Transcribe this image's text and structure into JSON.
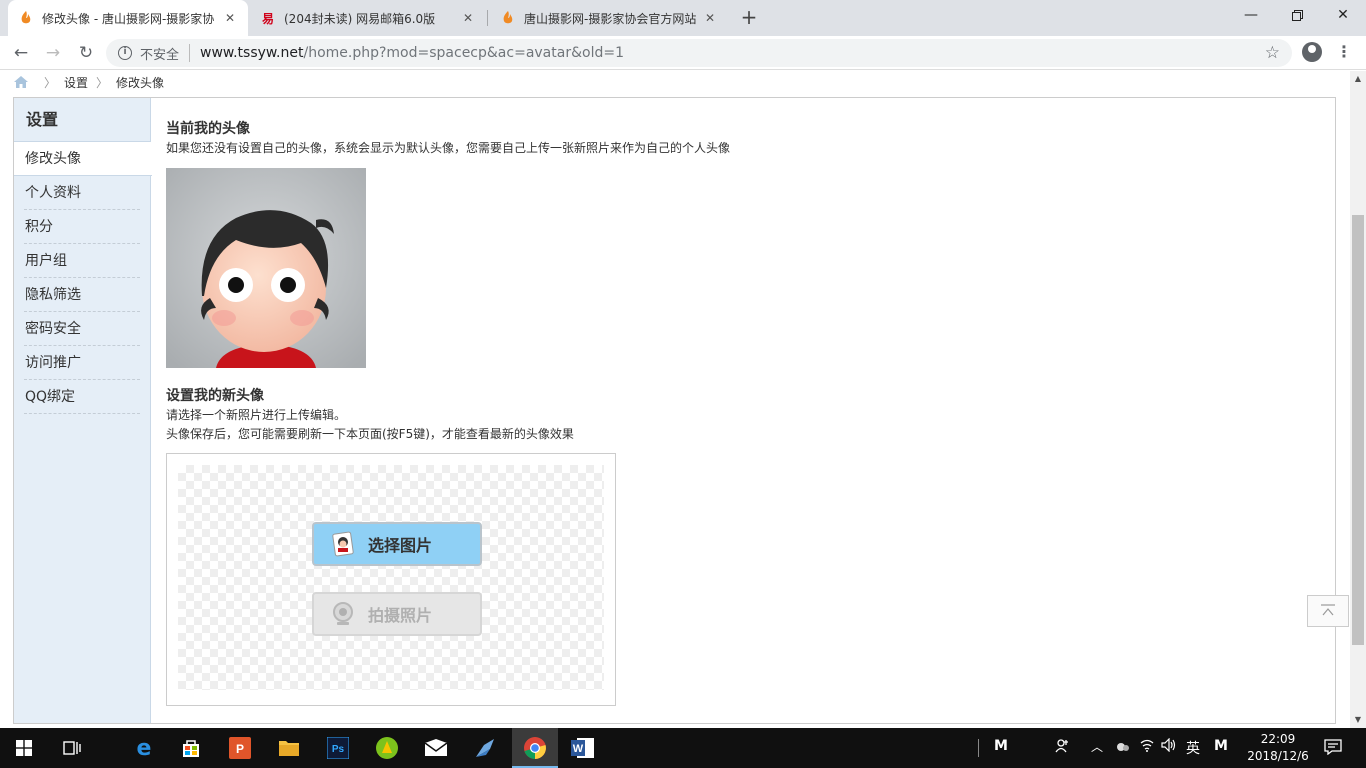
{
  "browser": {
    "tabs": [
      {
        "title": "修改头像 - 唐山摄影网-摄影家协",
        "active": true
      },
      {
        "title": "(204封未读) 网易邮箱6.0版",
        "active": false
      },
      {
        "title": "唐山摄影网-摄影家协会官方网站",
        "active": false
      }
    ],
    "security_label": "不安全",
    "url_host": "www.tssyw.net",
    "url_path": "/home.php?mod=spacecp&ac=avatar&old=1"
  },
  "breadcrumb": [
    "设置",
    "修改头像"
  ],
  "sidebar": {
    "title": "设置",
    "items": [
      "修改头像",
      "个人资料",
      "积分",
      "用户组",
      "隐私筛选",
      "密码安全",
      "访问推广",
      "QQ绑定"
    ],
    "active_index": 0
  },
  "current_avatar": {
    "title": "当前我的头像",
    "desc": "如果您还没有设置自己的头像，系统会显示为默认头像，您需要自己上传一张新照片来作为自己的个人头像"
  },
  "new_avatar": {
    "title": "设置我的新头像",
    "desc1": "请选择一个新照片进行上传编辑。",
    "desc2": "头像保存后，您可能需要刷新一下本页面(按F5键)，才能查看最新的头像效果"
  },
  "uploader": {
    "select_label": "选择图片",
    "camera_label": "拍摄照片"
  },
  "taskbar": {
    "ime_lang": "英",
    "time": "22:09",
    "date": "2018/12/6"
  },
  "colors": {
    "sidebar_bg": "#e5eef7",
    "select_button": "#8fd0f5"
  }
}
